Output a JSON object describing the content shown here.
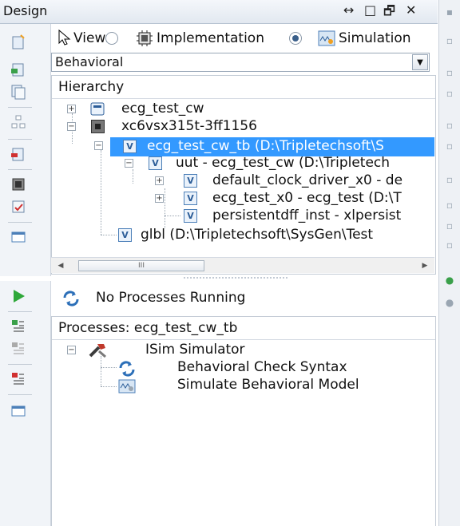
{
  "window": {
    "title": "Design",
    "controls": [
      "↔",
      "□",
      "🗗",
      "✕"
    ]
  },
  "view": {
    "label": "View:",
    "options": [
      {
        "label": "Implementation",
        "selected": false
      },
      {
        "label": "Simulation",
        "selected": true
      }
    ]
  },
  "dropdown": {
    "value": "Behavioral"
  },
  "hierarchy": {
    "header": "Hierarchy",
    "rows": [
      {
        "label": "ecg_test_cw",
        "icon": "project-icon"
      },
      {
        "label": "xc6vsx315t-3ff1156",
        "icon": "chip-icon"
      },
      {
        "label": "ecg_test_cw_tb (D:\\Tripletechsoft\\S",
        "icon": "vhdl-icon",
        "selected": true
      },
      {
        "label": "uut - ecg_test_cw (D:\\Tripletech",
        "icon": "vhdl-icon"
      },
      {
        "label": "default_clock_driver_x0 - de",
        "icon": "vhdl-icon"
      },
      {
        "label": "ecg_test_x0 - ecg_test (D:\\T",
        "icon": "vhdl-icon"
      },
      {
        "label": "persistentdff_inst - xlpersist",
        "icon": "vhdl-icon"
      },
      {
        "label": "glbl (D:\\Tripletechsoft\\SysGen\\Test",
        "icon": "vhdl-icon"
      }
    ],
    "scroll_thumb_label": "III"
  },
  "status": {
    "text": "No Processes Running"
  },
  "processes": {
    "header": "Processes: ecg_test_cw_tb",
    "rows": [
      {
        "label": "ISim Simulator",
        "icon": "tools-icon"
      },
      {
        "label": "Behavioral Check Syntax",
        "icon": "refresh-icon"
      },
      {
        "label": "Simulate Behavioral Model",
        "icon": "simulate-icon"
      }
    ]
  },
  "colors": {
    "selection": "#3399ff",
    "accent": "#3a5f8a"
  }
}
